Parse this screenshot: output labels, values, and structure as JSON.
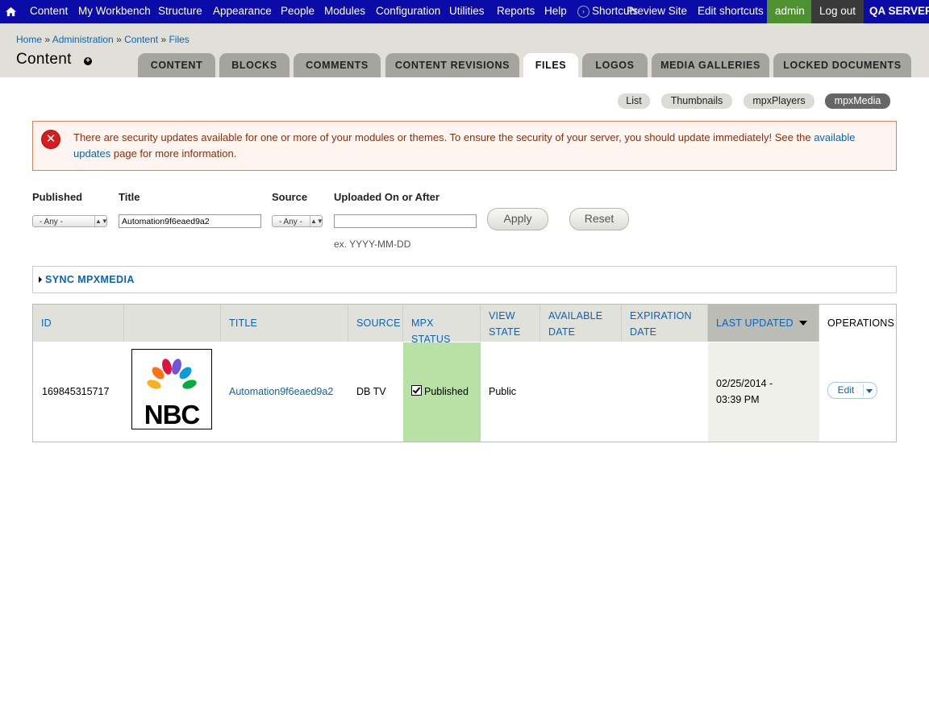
{
  "toolbar": {
    "items": [
      "Content",
      "My Workbench",
      "Structure",
      "Appearance",
      "People",
      "Modules",
      "Configuration",
      "Utilities",
      "Reports",
      "Help"
    ],
    "shortcuts": "Shortcuts",
    "preview_site": "Preview Site",
    "edit_shortcuts": "Edit shortcuts",
    "user": "admin",
    "logout": "Log out",
    "server": "QA SERVER"
  },
  "breadcrumb": [
    "Home",
    "Administration",
    "Content",
    "Files"
  ],
  "page_title": "Content",
  "tabs": [
    "CONTENT",
    "BLOCKS",
    "COMMENTS",
    "CONTENT REVISIONS",
    "FILES",
    "LOGOS",
    "MEDIA GALLERIES",
    "LOCKED DOCUMENTS"
  ],
  "active_tab": "FILES",
  "secondary_tabs": [
    "List",
    "Thumbnails",
    "mpxPlayers",
    "mpxMedia"
  ],
  "active_secondary_tab": "mpxMedia",
  "message": {
    "text_before": "There are security updates available for one or more of your modules or themes. To ensure the security of your server, you should update immediately! See the ",
    "link": "available updates",
    "text_after": " page for more information."
  },
  "filters": {
    "published_label": "Published",
    "published_value": "- Any -",
    "title_label": "Title",
    "title_value": "Automation9f6eaed9a2",
    "source_label": "Source",
    "source_value": "- Any -",
    "uploaded_label": "Uploaded On or After",
    "uploaded_value": "",
    "date_hint": "ex. YYYY-MM-DD",
    "apply": "Apply",
    "reset": "Reset"
  },
  "sync_label": "SYNC MPXMEDIA",
  "table": {
    "headers": {
      "id": "ID",
      "title": "TITLE",
      "source": "SOURCE",
      "mpx_status": "MPX STATUS",
      "view_state_1": "VIEW",
      "view_state_2": "STATE",
      "available_1": "AVAILABLE",
      "available_2": "DATE",
      "expiration_1": "EXPIRATION",
      "expiration_2": "DATE",
      "last_updated": "LAST UPDATED",
      "operations": "OPERATIONS"
    },
    "row": {
      "id": "169845315717",
      "logo_text": "NBC",
      "title": "Automation9f6eaed9a2",
      "source": "DB TV",
      "mpx_status": "Published",
      "view_state": "Public",
      "available_date": "",
      "expiration_date": "",
      "last_updated_1": "02/25/2014 -",
      "last_updated_2": "03:39 PM",
      "edit": "Edit"
    }
  },
  "colors": {
    "toolbar": "#0b0ba8",
    "link": "#0b63b6",
    "status_published": "#b9e0a5",
    "message_border": "#e37d58"
  }
}
